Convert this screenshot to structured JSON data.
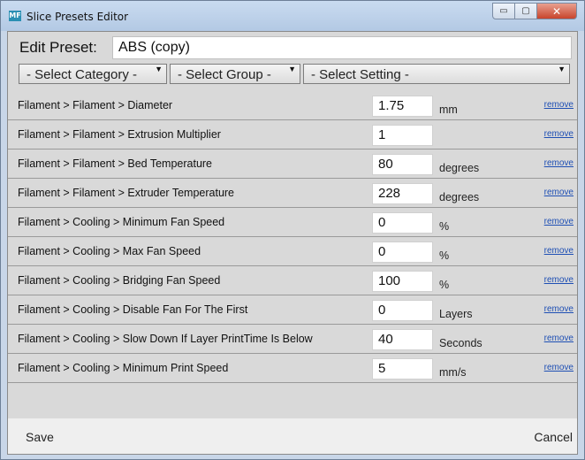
{
  "window": {
    "title": "Slice Presets Editor",
    "app_icon_text": "MF",
    "minimize_glyph": "▭",
    "maximize_glyph": "▢",
    "close_glyph": "✕"
  },
  "edit": {
    "label": "Edit Preset:",
    "value": "ABS (copy)"
  },
  "selectors": {
    "category": "- Select Category -",
    "group": "- Select Group -",
    "setting": "- Select Setting -",
    "arrow_glyph": "▼"
  },
  "rows": [
    {
      "name": "Filament > Filament > Diameter",
      "value": "1.75",
      "unit": "mm",
      "remove": "remove"
    },
    {
      "name": "Filament > Filament > Extrusion Multiplier",
      "value": "1",
      "unit": "",
      "remove": "remove"
    },
    {
      "name": "Filament > Filament > Bed Temperature",
      "value": "80",
      "unit": "degrees",
      "remove": "remove"
    },
    {
      "name": "Filament > Filament > Extruder Temperature",
      "value": "228",
      "unit": "degrees",
      "remove": "remove"
    },
    {
      "name": "Filament > Cooling > Minimum Fan Speed",
      "value": "0",
      "unit": "%",
      "remove": "remove"
    },
    {
      "name": "Filament > Cooling > Max Fan Speed",
      "value": "0",
      "unit": "%",
      "remove": "remove"
    },
    {
      "name": "Filament > Cooling > Bridging Fan Speed",
      "value": "100",
      "unit": "%",
      "remove": "remove"
    },
    {
      "name": "Filament > Cooling > Disable Fan For The First",
      "value": "0",
      "unit": "Layers",
      "remove": "remove"
    },
    {
      "name": "Filament > Cooling > Slow Down If Layer PrintTime Is Below",
      "value": "40",
      "unit": "Seconds",
      "remove": "remove"
    },
    {
      "name": "Filament > Cooling > Minimum Print Speed",
      "value": "5",
      "unit": "mm/s",
      "remove": "remove"
    }
  ],
  "footer": {
    "save": "Save",
    "cancel": "Cancel"
  }
}
